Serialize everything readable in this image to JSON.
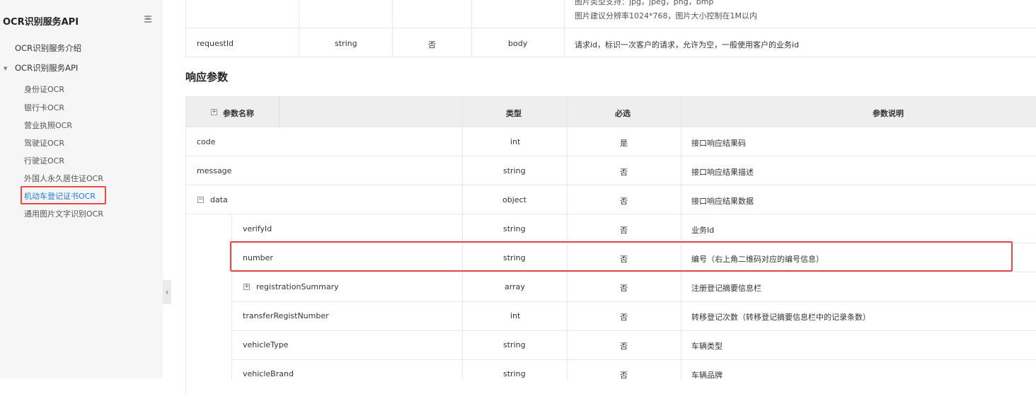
{
  "sidebar": {
    "title": "OCR识别服务API",
    "toggle_icon": "collapse-menu-icon",
    "items": [
      {
        "label": "OCR识别服务介绍"
      },
      {
        "label": "OCR识别服务API"
      }
    ],
    "sub_items": [
      {
        "label": "身份证OCR"
      },
      {
        "label": "银行卡OCR"
      },
      {
        "label": "营业执照OCR"
      },
      {
        "label": "驾驶证OCR"
      },
      {
        "label": "行驶证OCR"
      },
      {
        "label": "外国人永久居住证OCR"
      },
      {
        "label": "机动车登记证书OCR"
      },
      {
        "label": "通用图片文字识别OCR"
      }
    ],
    "active_index": 6
  },
  "request_table": {
    "partial_desc_line1": "图片类型支持：jpg，jpeg，png，bmp",
    "partial_desc_line2": "图片建议分辨率1024*768，图片大小控制在1M以内",
    "row": {
      "name": "requestId",
      "type": "string",
      "required": "否",
      "location": "body",
      "desc": "请求id，标识一次客户的请求，允许为空，一般使用客户的业务id"
    }
  },
  "response": {
    "section_title": "响应参数",
    "headers": {
      "name": "参数名称",
      "type": "类型",
      "required": "必选",
      "desc": "参数说明"
    },
    "rows": [
      {
        "name": "code",
        "type": "int",
        "required": "是",
        "desc": "接口响应结果码"
      },
      {
        "name": "message",
        "type": "string",
        "required": "否",
        "desc": "接口响应结果描述"
      },
      {
        "name": "data",
        "type": "object",
        "required": "否",
        "desc": "接口响应结果数据"
      },
      {
        "name": "verifyId",
        "type": "string",
        "required": "否",
        "desc": "业务Id"
      },
      {
        "name": "number",
        "type": "string",
        "required": "否",
        "desc": "编号（右上角二维码对应的编号信息）"
      },
      {
        "name": "registrationSummary",
        "type": "array",
        "required": "否",
        "desc": "注册登记摘要信息栏"
      },
      {
        "name": "transferRegistNumber",
        "type": "int",
        "required": "否",
        "desc": "转移登记次数（转移登记摘要信息栏中的记录条数）"
      },
      {
        "name": "vehicleType",
        "type": "string",
        "required": "否",
        "desc": "车辆类型"
      },
      {
        "name": "vehicleBrand",
        "type": "string",
        "required": "否",
        "desc": "车辆品牌"
      }
    ]
  },
  "colors": {
    "highlight": "#e84848",
    "active_link": "#1e7ad4"
  }
}
